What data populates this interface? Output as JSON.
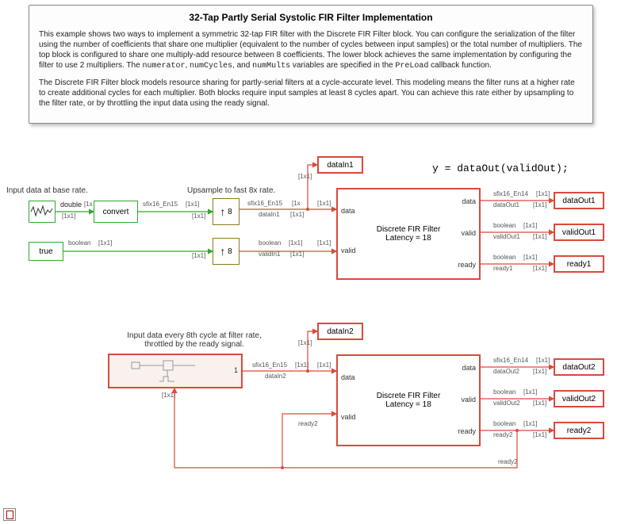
{
  "doc": {
    "title": "32-Tap Partly Serial Systolic FIR Filter Implementation",
    "p1_a": "This example shows two ways to implement a symmetric 32-tap FIR filter with the Discrete FIR Filter block. You can configure the serialization of the filter using the number of coefficients that share one multiplier (equivalent to the number of cycles between input samples) or the total number of multipliers. The top block is configured to share one multiply-add resource between 8 coefficients. The lower block achieves the same implementation by configuring the filter to use 2 multipliers. The ",
    "p1_b": "numerator",
    "p1_c": ", ",
    "p1_d": "numCycles",
    "p1_e": ", and ",
    "p1_f": "numMults",
    "p1_g": " variables are specified in the ",
    "p1_h": "PreLoad",
    "p1_i": " callback function.",
    "p2": "The Discrete FIR Filter block models resource sharing for partly-serial filters at a cycle-accurate level. This modeling means the filter runs at a higher rate to create additional cycles for each multiplier. Both blocks require input samples at least 8 cycles apart. You can achieve this rate either by upsampling to the filter rate, or by throttling the input data using the ready signal."
  },
  "code_line": "y = dataOut(validOut);",
  "annotations": {
    "base_rate": "Input data at base rate.",
    "upsample": "Upsample to fast 8x rate.",
    "throttle1": "Input data every 8th cycle at filter rate,",
    "throttle2": "throttled by the ready signal."
  },
  "signals": {
    "double": "double",
    "sfix_in": "sfix16_En15",
    "sfix_out": "sfix16_En14",
    "boolean": "boolean",
    "dim": "[1x1]",
    "dim_bracket_open": "[1x",
    "one": "1"
  },
  "blocks": {
    "convert": "convert",
    "true": "true",
    "upsample": "8",
    "filter_name": "Discrete FIR Filter",
    "filter_lat": "Latency = 18",
    "dataIn1": "dataIn1",
    "dataIn2": "dataIn2",
    "dataOut1": "dataOut1",
    "validOut1": "validOut1",
    "ready1": "ready1",
    "dataOut2": "dataOut2",
    "validOut2": "validOut2",
    "ready2": "ready2"
  },
  "ports": {
    "data": "data",
    "valid": "valid",
    "ready": "ready",
    "dataIn1": "dataIn1",
    "validIn1": "validIn1",
    "dataIn2": "dataIn2",
    "dataOut1": "dataOut1",
    "validOut1": "validOut1",
    "ready1": "ready1",
    "dataOut2": "dataOut2",
    "validOut2": "validOut2",
    "ready2": "ready2"
  }
}
